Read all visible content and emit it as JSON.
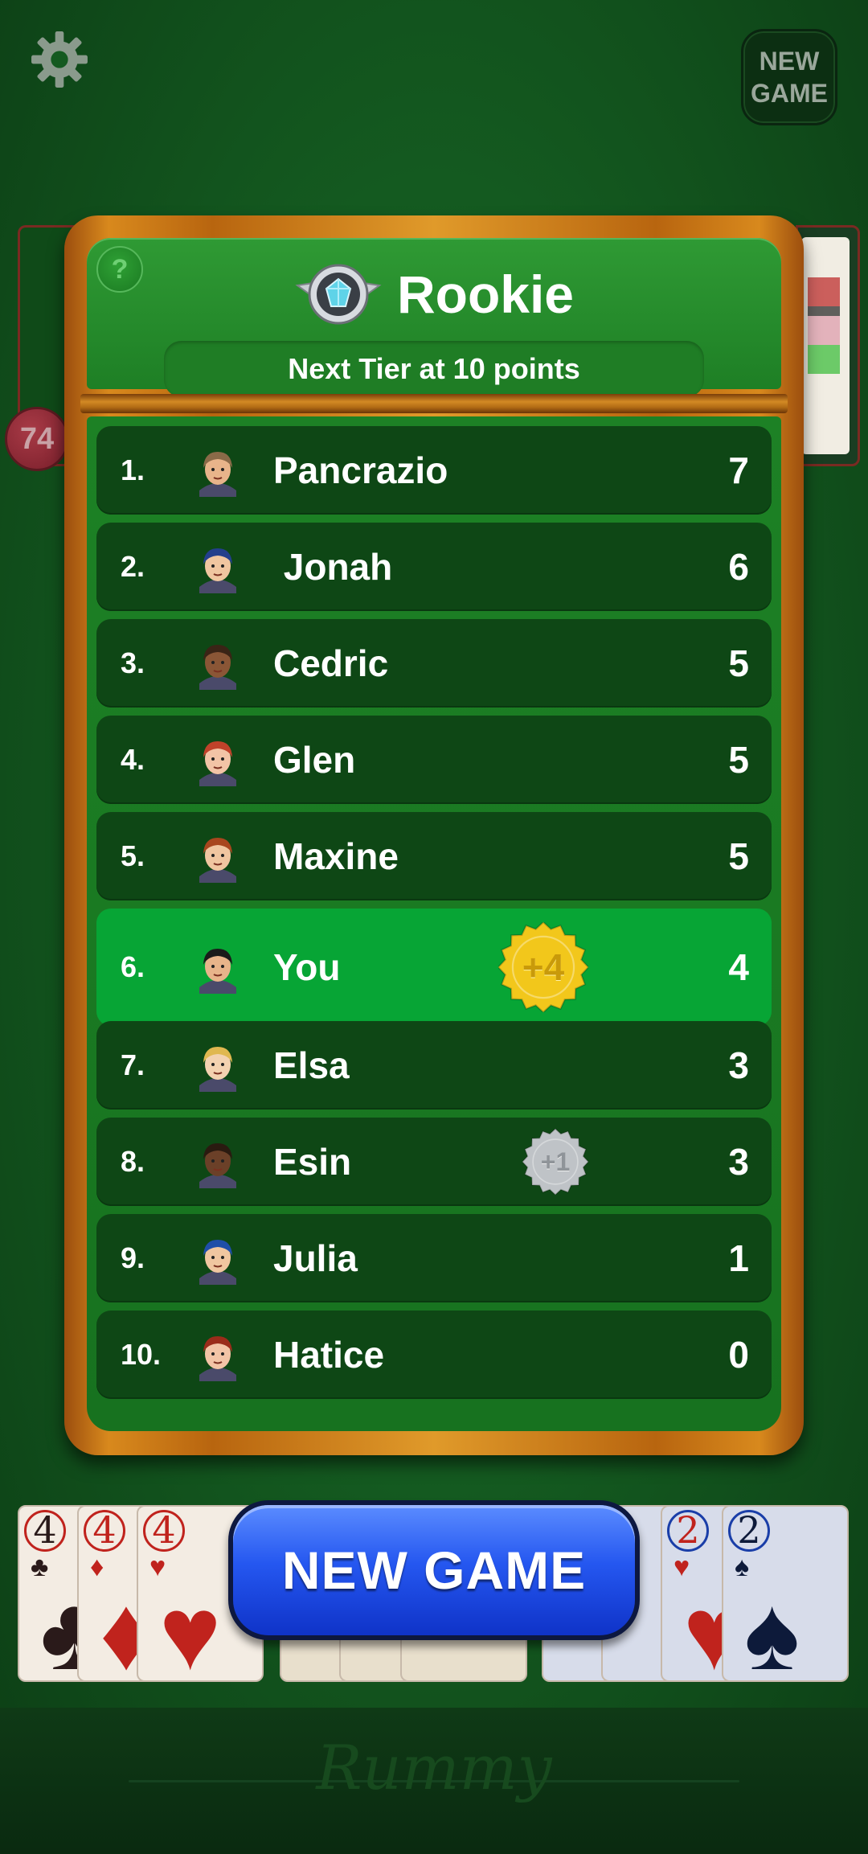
{
  "top_bar": {
    "settings_icon": "gear-icon",
    "new_game_line1": "NEW",
    "new_game_line2": "GAME"
  },
  "table": {
    "pile_count": "74"
  },
  "leaderboard": {
    "help_label": "?",
    "tier_icon": "diamond-badge-icon",
    "tier_name": "Rookie",
    "next_tier_text": "Next Tier at 10 points",
    "highlight_color": "#07a535",
    "players": [
      {
        "rank": "1.",
        "name": "Pancrazio",
        "score": "7",
        "avatar": "avatar-mustache-man"
      },
      {
        "rank": "2.",
        "name": " Jonah",
        "score": "6",
        "avatar": "avatar-blue-hair-woman"
      },
      {
        "rank": "3.",
        "name": "Cedric",
        "score": "5",
        "avatar": "avatar-curly-hair-woman"
      },
      {
        "rank": "4.",
        "name": "Glen",
        "score": "5",
        "avatar": "avatar-red-hair-woman"
      },
      {
        "rank": "5.",
        "name": "Maxine",
        "score": "5",
        "avatar": "avatar-auburn-hair-woman"
      },
      {
        "rank": "6.",
        "name": "You",
        "score": "4",
        "avatar": "avatar-bearded-man",
        "bonus": "+4",
        "bonus_color": "#f2c71b",
        "is_current_user": true
      },
      {
        "rank": "7.",
        "name": "Elsa",
        "score": "3",
        "avatar": "avatar-blond-man"
      },
      {
        "rank": "8.",
        "name": "Esin",
        "score": "3",
        "avatar": "avatar-dreadlocks-man",
        "bonus": "+1",
        "bonus_color": "#bfc3c7"
      },
      {
        "rank": "9.",
        "name": "Julia",
        "score": "1",
        "avatar": "avatar-cap-boy"
      },
      {
        "rank": "10.",
        "name": "Hatice",
        "score": "0",
        "avatar": "avatar-redhead-girl"
      }
    ]
  },
  "hand": {
    "left_cards": [
      {
        "rank": "4",
        "suit": "♣",
        "color": "#2a1a1a"
      },
      {
        "rank": "4",
        "suit": "♦",
        "color": "#c0231d"
      },
      {
        "rank": "4",
        "suit": "♥",
        "color": "#c0231d"
      }
    ],
    "right_cards": [
      {
        "rank": "2",
        "suit": "♥",
        "color": "#c0231d"
      },
      {
        "rank": "2",
        "suit": "♠",
        "color": "#0d1a3a"
      }
    ]
  },
  "new_game_button": {
    "label": "NEW GAME"
  },
  "footer": {
    "logo_text": "Rummy"
  }
}
